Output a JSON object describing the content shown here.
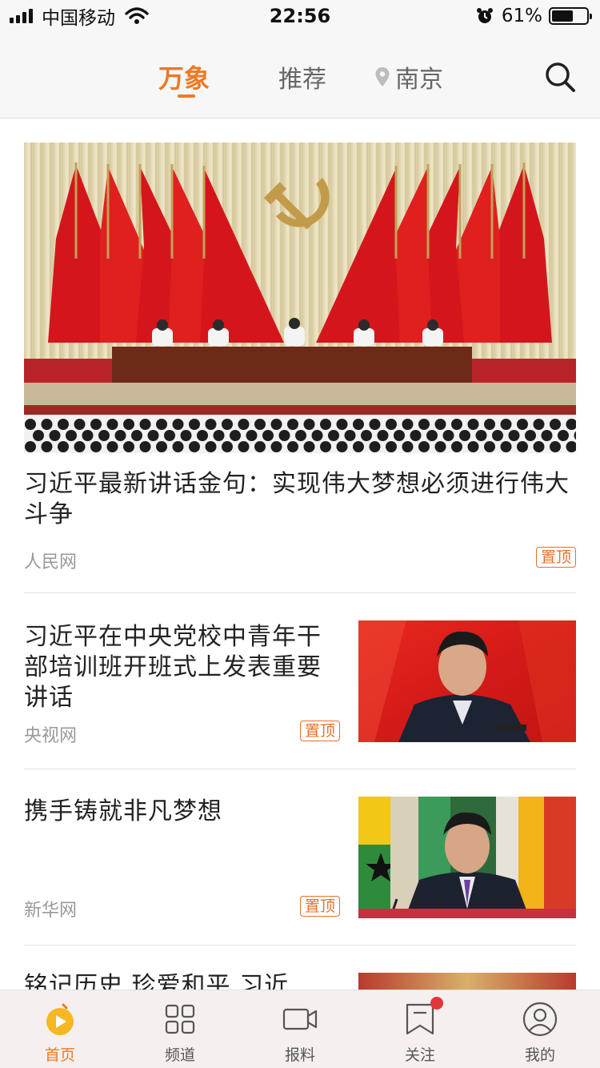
{
  "status": {
    "carrier": "中国移动",
    "time": "22:56",
    "battery_pct": "61%",
    "battery_level": 0.61
  },
  "nav": {
    "tabs": [
      "万象",
      "推荐",
      "南京"
    ],
    "active_tab": "万象"
  },
  "articles": [
    {
      "title": "习近平最新讲话金句：实现伟大梦想必须进行伟大斗争",
      "source": "人民网",
      "badge": "置顶"
    },
    {
      "title": "习近平在中央党校中青年干部培训班开班式上发表重要讲话",
      "source": "央视网",
      "badge": "置顶"
    },
    {
      "title": "携手铸就非凡梦想",
      "source": "新华网",
      "badge": "置顶"
    },
    {
      "title": "铭记历史 珍爱和平 习近"
    }
  ],
  "tabbar": {
    "items": [
      "首页",
      "频道",
      "报料",
      "关注",
      "我的"
    ],
    "active": "首页"
  },
  "colors": {
    "accent": "#f07822",
    "notification": "#e6353a"
  }
}
